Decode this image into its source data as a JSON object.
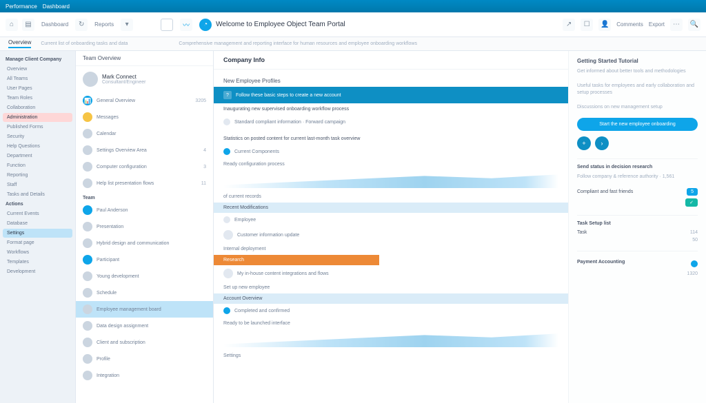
{
  "titlebar": {
    "l1": "Performance",
    "l2": "Dashboard"
  },
  "toolbar": {
    "tab1": "Dashboard",
    "tab2": "Reports",
    "title": "Welcome to Employee Object Team Portal",
    "right_labels": [
      "Comments",
      "Export"
    ],
    "sub_desc": "Comprehensive management and reporting interface for human resources and employee onboarding workflows"
  },
  "secondary": {
    "tab": "Overview",
    "desc": "Current list of onboarding tasks and data"
  },
  "left_nav": {
    "sections": [
      {
        "title": "Manage Client Company",
        "items": [
          "Overview",
          "All Teams",
          "User Pages",
          "Team Roles",
          "Collaboration"
        ]
      },
      {
        "title": "",
        "items": [
          "Administration",
          "Published Forms",
          "Security",
          "Help Questions"
        ]
      },
      {
        "title": "",
        "items": [
          "Department",
          "Function",
          "Reporting",
          "Staff",
          "Tasks and Details"
        ]
      },
      {
        "title": "Actions",
        "items": [
          "Current Events",
          "Database"
        ]
      },
      {
        "title": "",
        "items": [
          "Settings",
          "Format page",
          "Workflows",
          "Templates",
          "Development"
        ]
      }
    ],
    "sel_index": 5,
    "sel2_index": 16
  },
  "panel": {
    "header": "Team Overview",
    "user": {
      "name": "Mark Connect",
      "role": "Consultant/Engineer",
      "points": "3205"
    },
    "subrow": "General Overview",
    "groups": [
      {
        "name": "Messages",
        "icon_bg": "#f6c445"
      },
      {
        "name": "Calendar"
      },
      {
        "name": "Settings Overview Area",
        "meta": "4"
      },
      {
        "name": "Computer configuration",
        "meta": "3"
      },
      {
        "name": "Help list presentation flows",
        "meta": "11"
      }
    ],
    "g2_title": "Team",
    "groups2": [
      {
        "name": "Paul Anderson",
        "icon_bg": "#0ea5e9"
      },
      {
        "name": "Presentation"
      },
      {
        "name": "Hybrid design and communication"
      },
      {
        "name": "Participant",
        "icon_bg": "#0ea5e9"
      },
      {
        "name": "Young development"
      },
      {
        "name": "Schedule"
      },
      {
        "name": "Employee management board",
        "active": true
      },
      {
        "name": "Data design assignment"
      },
      {
        "name": "Client and subscription"
      },
      {
        "name": "Profile"
      },
      {
        "name": "Integration"
      }
    ]
  },
  "content": {
    "header": "Company Info",
    "card1_title": "New Employee Profiles",
    "banner": "Follow these basic steps to create a new account",
    "desc": "Inaugurating new supervised onboarding workflow process",
    "sub1": "Standard compliant information · Forward campaign",
    "sec1": "Statistics on posted content for current last-month task overview",
    "item_a": "Current Components",
    "item_b": "Ready configuration process",
    "item_c": "of current records",
    "label2": "Recent Modifications",
    "item_d": "Employee",
    "item_e": "Customer information update",
    "item_f": "Internal deployment",
    "label3": "Research",
    "item_g": "My in-house content integrations and flows",
    "item_h": "Set up new employee",
    "label4": "Account Overview",
    "item_i": "Completed and confirmed",
    "item_j": "Ready to be launched interface",
    "item_k": "Settings"
  },
  "aside": {
    "title": "Getting Started Tutorial",
    "p1": "Get informed about better tools and methodologies",
    "p2": "Useful tasks for employees and early collaboration and setup processes",
    "p3": "Discussions on new management setup",
    "cta": "Start the new employee onboarding",
    "sec2_title": "Send status in decision research",
    "sec2_sub": "Follow company & reference authority · 1,561",
    "row1": "Compliant and fast friends",
    "badge1": "5",
    "row2": "",
    "sec3_title": "Task Setup list",
    "row3": "Task",
    "meta3": "114",
    "row4": "",
    "meta4": "50",
    "sec4_title": "Payment Accounting",
    "meta5": "1320"
  }
}
